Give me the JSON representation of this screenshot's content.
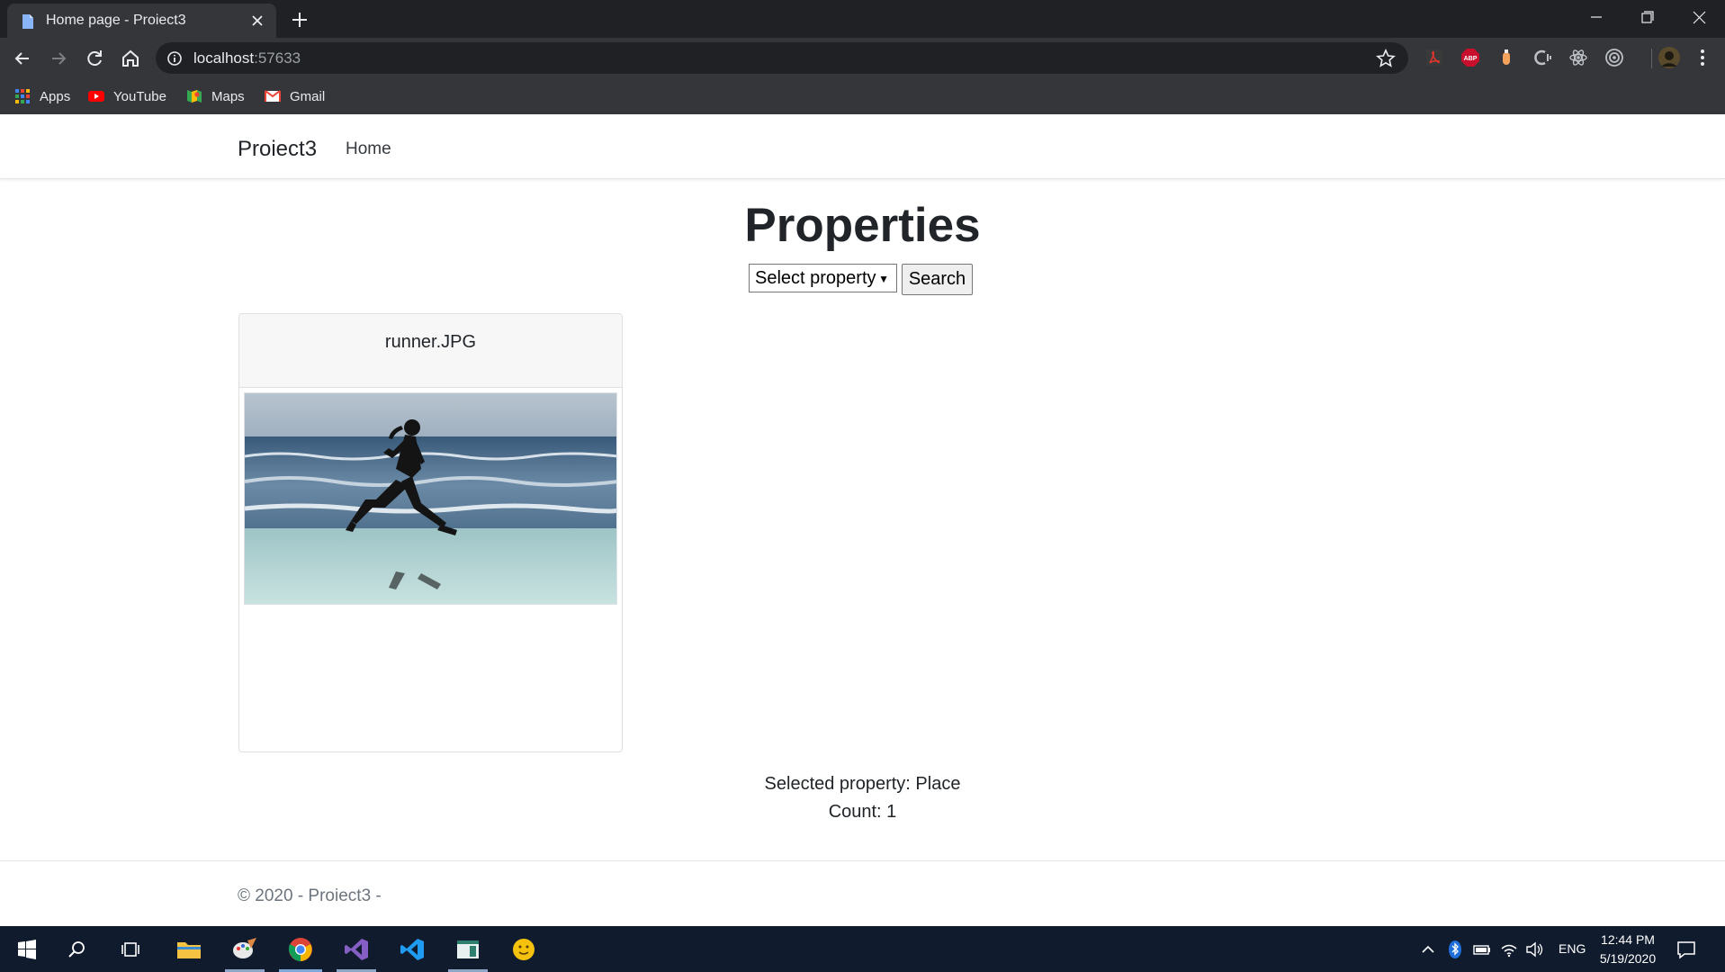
{
  "browser": {
    "tab_title": "Home page - Proiect3",
    "url_host": "localhost",
    "url_port": ":57633",
    "bookmarks": [
      {
        "label": "Apps",
        "icon": "apps-grid-icon"
      },
      {
        "label": "YouTube",
        "icon": "youtube-icon"
      },
      {
        "label": "Maps",
        "icon": "maps-icon"
      },
      {
        "label": "Gmail",
        "icon": "gmail-icon"
      }
    ]
  },
  "navbar": {
    "brand": "Proiect3",
    "home": "Home"
  },
  "main": {
    "title": "Properties",
    "select_value": "Select property",
    "search_label": "Search",
    "card_title": "runner.JPG",
    "selected_text": "Selected property: Place",
    "count_text": "Count: 1"
  },
  "footer": {
    "text": "© 2020 - Proiect3 -"
  },
  "taskbar": {
    "lang": "ENG",
    "time": "12:44 PM",
    "date": "5/19/2020"
  },
  "colors": {
    "chrome_dark": "#202124",
    "chrome_toolbar": "#35363a",
    "taskbar": "#101b2e",
    "text": "#212529"
  }
}
